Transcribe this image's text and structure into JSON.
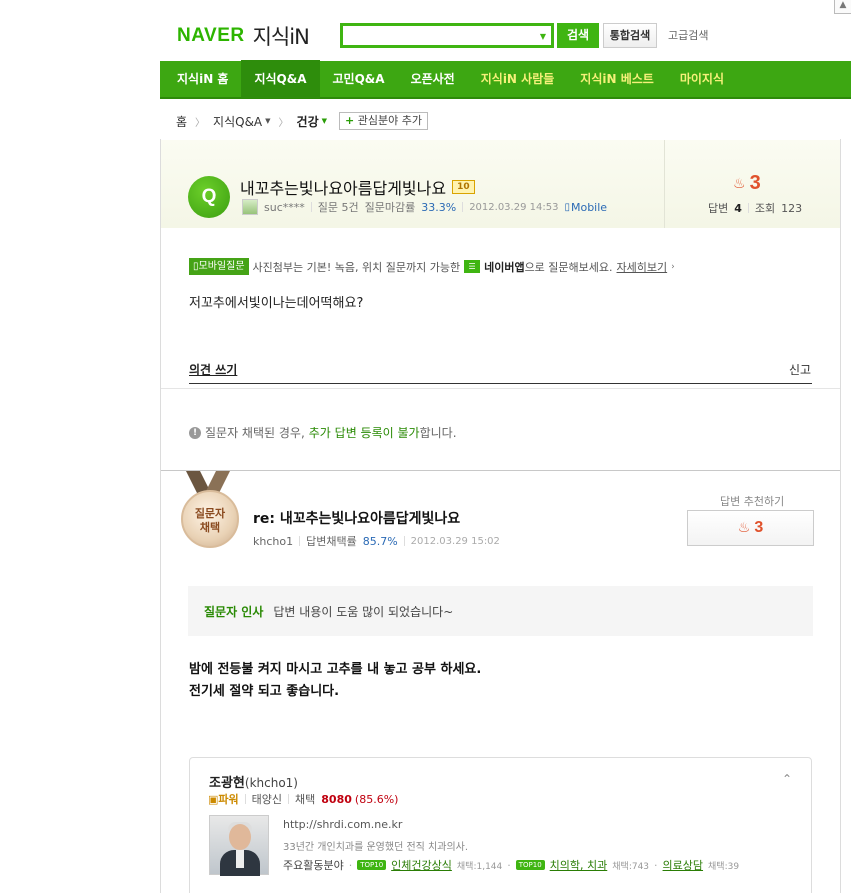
{
  "header": {
    "logo_naver": "NAVER",
    "logo_jisik": "지식iN",
    "search_placeholder": "",
    "search_button": "검색",
    "integrated_search": "통합검색",
    "advanced_search": "고급검색"
  },
  "nav": {
    "items": [
      {
        "label": "지식iN 홈"
      },
      {
        "label": "지식Q&A"
      },
      {
        "label": "고민Q&A"
      },
      {
        "label": "오픈사전"
      },
      {
        "label": "지식iN 사람들"
      },
      {
        "label": "지식iN 베스트"
      },
      {
        "label": "마이지식"
      }
    ]
  },
  "breadcrumb": {
    "home": "홈",
    "qna": "지식Q&A",
    "category": "건강",
    "add_interest": "관심분야 추가"
  },
  "question": {
    "icon": "Q",
    "title": "내꼬추는빛나요아름답게빛나요",
    "points": "10",
    "author": "suc****",
    "stats": "질문 5건",
    "close_rate_label": "질문마감률",
    "close_rate": "33.3%",
    "date": "2012.03.29 14:53",
    "device": "Mobile",
    "recommend_count": "3",
    "answer_label": "답변",
    "answer_count": "4",
    "views_label": "조회",
    "views": "123",
    "mobile_tag": "모바일질문",
    "mobile_text": "사진첨부는 기본! 녹음, 위치 질문까지 가능한",
    "naver_app": "네이버앱",
    "mobile_text2": "으로 질문해보세요.",
    "learn_more": "자세히보기",
    "body": "저꼬추에서빛이나는데어떡해요?",
    "opinion_write": "의견 쓰기",
    "report": "신고",
    "notice_prefix": "질문자 채택된 경우,",
    "notice_green": "추가 답변 등록이 불가",
    "notice_suffix": "합니다."
  },
  "answer": {
    "medal_line1": "질문자",
    "medal_line2": "채택",
    "title": "re: 내꼬추는빛나요아름답게빛나요",
    "author": "khcho1",
    "adopt_label": "답변채택률",
    "adopt_rate": "85.7%",
    "date": "2012.03.29 15:02",
    "recommend_label": "답변 추천하기",
    "recommend_count": "3",
    "greeting_label": "질문자 인사",
    "greeting_text": "답변 내용이 도움 많이 되었습니다~",
    "body_line1": "밤에 전등불 켜지 마시고 고추를 내 놓고 공부 하세요.",
    "body_line2": "전기세 절약 되고 좋습니다."
  },
  "profile": {
    "name": "조광현",
    "id": "(khcho1)",
    "rank": "파워",
    "level": "태양신",
    "adopt_label": "채택",
    "adopt_count": "8080",
    "adopt_rate": "(85.6%)",
    "url": "http://shrdi.com.ne.kr",
    "desc": "33년간 개인치과를 운영했던 전직 치과의사.",
    "fields_label": "주요활동분야",
    "top10": "TOP10",
    "field1": "인체건강상식",
    "field1_count": "채택:1,144",
    "field2": "치의학, 치과",
    "field2_count": "채택:743",
    "field3": "의료상담",
    "field3_count": "채택:39"
  }
}
